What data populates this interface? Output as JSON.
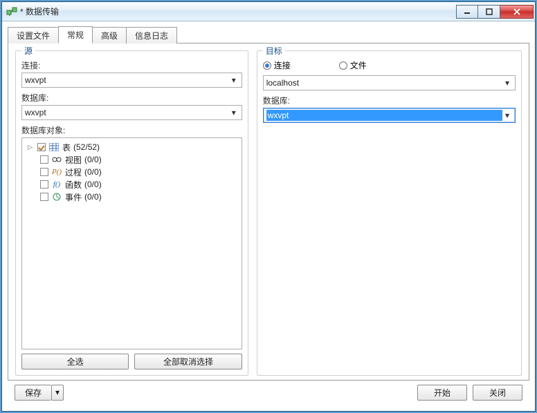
{
  "window": {
    "title": "* 数据传输"
  },
  "tabs": [
    "设置文件",
    "常规",
    "高级",
    "信息日志"
  ],
  "active_tab": 1,
  "source": {
    "legend": "源",
    "connection_label": "连接:",
    "connection_value": "wxvpt",
    "database_label": "数据库:",
    "database_value": "wxvpt",
    "objects_label": "数据库对象:",
    "items": [
      {
        "label": "表",
        "count": "(52/52)",
        "icon": "table",
        "expander": true,
        "checked": true
      },
      {
        "label": "视图",
        "count": "(0/0)",
        "icon": "view",
        "expander": false,
        "checked": false
      },
      {
        "label": "过程",
        "count": "(0/0)",
        "icon": "procedure",
        "expander": false,
        "checked": false
      },
      {
        "label": "函数",
        "count": "(0/0)",
        "icon": "function",
        "expander": false,
        "checked": false
      },
      {
        "label": "事件",
        "count": "(0/0)",
        "icon": "event",
        "expander": false,
        "checked": false
      }
    ],
    "select_all": "全选",
    "deselect_all": "全部取消选择"
  },
  "target": {
    "legend": "目标",
    "radio_connection": "连接",
    "radio_file": "文件",
    "connection_value": "localhost",
    "database_label": "数据库:",
    "database_value": "wxvpt"
  },
  "footer": {
    "save": "保存",
    "start": "开始",
    "close": "关闭"
  }
}
